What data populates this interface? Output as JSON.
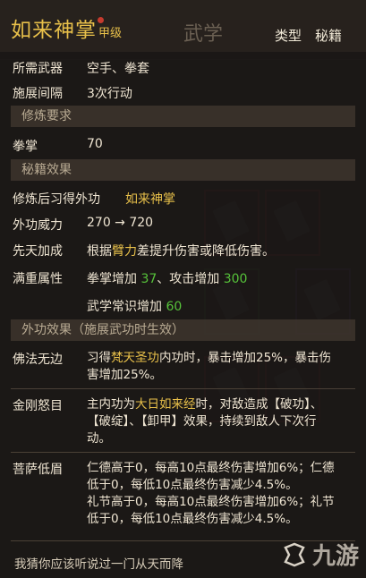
{
  "header": {
    "skill_name": "如来神掌",
    "grade": "甲级",
    "bg_tab": "武学",
    "type_label": "类型",
    "type_value": "秘籍"
  },
  "rows": {
    "weapon_label": "所需武器",
    "weapon_value": "空手、拳套",
    "interval_label": "施展间隔",
    "interval_value": "3次行动"
  },
  "sections": {
    "requirement": "修炼要求",
    "effect": "秘籍效果",
    "external": "外功效果（施展武功时生效）"
  },
  "requirement": {
    "label": "拳掌",
    "value": "70"
  },
  "effect_rows": {
    "learn_label": "修炼后习得外功",
    "learn_value": "如来神掌",
    "power_label": "外功威力",
    "power_value": "270 → 720",
    "innate_label": "先天加成",
    "innate_pre": "根据",
    "innate_hl": "臂力",
    "innate_post": "差提升伤害或降低伤害。",
    "attr_label": "满重属性",
    "attr_line1_a": "拳掌增加 ",
    "attr_line1_b": "37",
    "attr_line1_c": "、攻击增加 ",
    "attr_line1_d": "300",
    "attr_line2_a": "武学常识增加 ",
    "attr_line2_b": "60"
  },
  "external_rows": {
    "fofa_label": "佛法无边",
    "fofa_1a": "习得",
    "fofa_1b": "梵天圣功",
    "fofa_1c": "内功时，暴击增加25%，暴击伤",
    "fofa_2": "害增加25%。",
    "jingang_label": "金刚怒目",
    "jingang_1a": "主内功为",
    "jingang_1b": "大日如来经",
    "jingang_1c": "时，对敌造成【破功】、",
    "jingang_2": "【破绽】、【卸甲】效果，持续到敌人下次行",
    "jingang_3": "动。",
    "pusa_label": "菩萨低眉",
    "pusa_1": "仁德高于0，每高10点最终伤害增加6%；仁德",
    "pusa_2": "低于0，每低10点最终伤害减少4.5%。",
    "pusa_3": "礼节高于0，每高10点最终伤害增加6%；礼节",
    "pusa_4": "低于0，每低10点最终伤害减少4.5%。"
  },
  "footer": {
    "text": "我猜你应该听说过一门从天而降"
  },
  "watermark": {
    "text": "九游"
  }
}
